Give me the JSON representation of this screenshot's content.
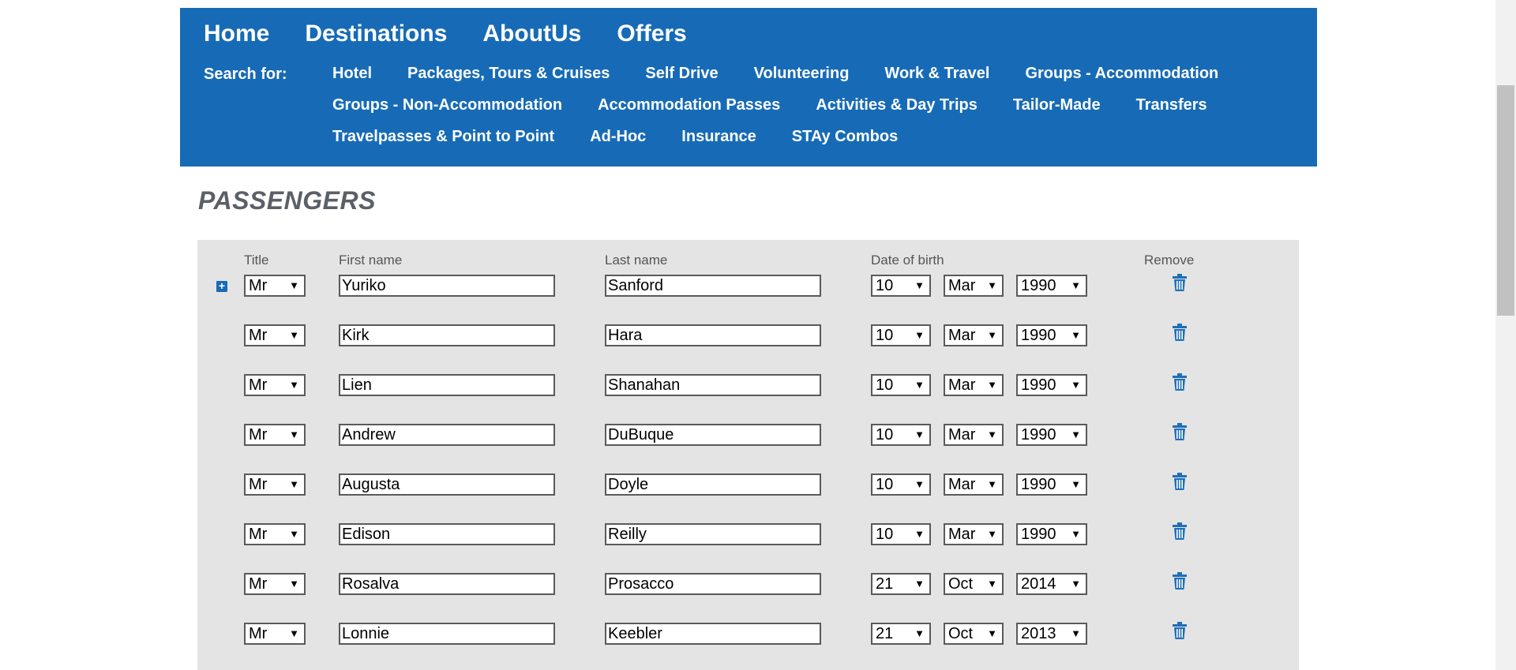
{
  "nav": {
    "main_links": [
      "Home",
      "Destinations",
      "AboutUs",
      "Offers"
    ],
    "search_label": "Search for:",
    "search_links": [
      "Hotel",
      "Packages, Tours & Cruises",
      "Self Drive",
      "Volunteering",
      "Work & Travel",
      "Groups - Accommodation",
      "Groups - Non-Accommodation",
      "Accommodation Passes",
      "Activities & Day Trips",
      "Tailor-Made",
      "Transfers",
      "Travelpasses & Point to Point",
      "Ad-Hoc",
      "Insurance",
      "STAy Combos"
    ]
  },
  "heading": "PASSENGERS",
  "columns": {
    "title": "Title",
    "first_name": "First name",
    "last_name": "Last name",
    "dob": "Date of birth",
    "remove": "Remove"
  },
  "icons": {
    "add": "plus-square-icon",
    "remove": "trash-icon"
  },
  "colors": {
    "nav_bg": "#176bb6",
    "panel_bg": "#e4e4e4",
    "heading": "#5b6068"
  },
  "passengers": [
    {
      "title": "Mr",
      "first": "Yuriko",
      "last": "Sanford",
      "day": "10",
      "month": "Mar",
      "year": "1990"
    },
    {
      "title": "Mr",
      "first": "Kirk",
      "last": "Hara",
      "day": "10",
      "month": "Mar",
      "year": "1990"
    },
    {
      "title": "Mr",
      "first": "Lien",
      "last": "Shanahan",
      "day": "10",
      "month": "Mar",
      "year": "1990"
    },
    {
      "title": "Mr",
      "first": "Andrew",
      "last": "DuBuque",
      "day": "10",
      "month": "Mar",
      "year": "1990"
    },
    {
      "title": "Mr",
      "first": "Augusta",
      "last": "Doyle",
      "day": "10",
      "month": "Mar",
      "year": "1990"
    },
    {
      "title": "Mr",
      "first": "Edison",
      "last": "Reilly",
      "day": "10",
      "month": "Mar",
      "year": "1990"
    },
    {
      "title": "Mr",
      "first": "Rosalva",
      "last": "Prosacco",
      "day": "21",
      "month": "Oct",
      "year": "2014"
    },
    {
      "title": "Mr",
      "first": "Lonnie",
      "last": "Keebler",
      "day": "21",
      "month": "Oct",
      "year": "2013"
    }
  ]
}
